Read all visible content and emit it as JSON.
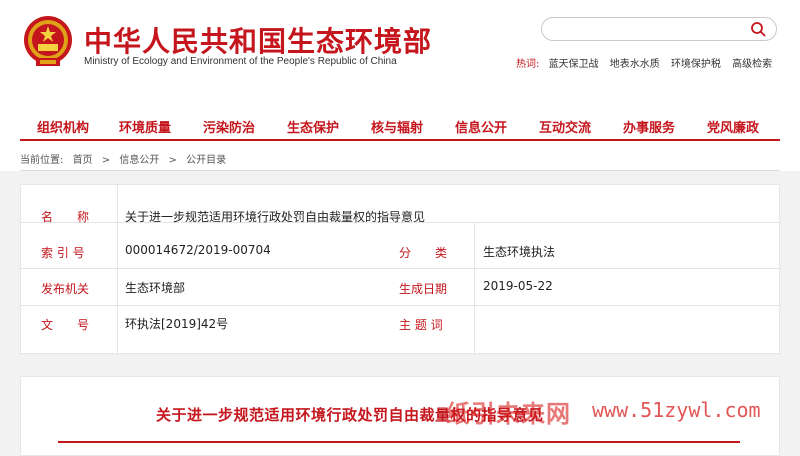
{
  "header": {
    "title_cn": "中华人民共和国生态环境部",
    "title_en": "Ministry of Ecology and Environment of the People's Republic of China",
    "emblem_icon": "national-emblem-icon",
    "brand_color": "#c4161c"
  },
  "search": {
    "placeholder": "",
    "icon": "search-icon"
  },
  "hotwords": {
    "label": "热词:",
    "items": [
      "蓝天保卫战",
      "地表水水质",
      "环境保护税",
      "高级检索"
    ]
  },
  "nav": {
    "items": [
      "组织机构",
      "环境质量",
      "污染防治",
      "生态保护",
      "核与辐射",
      "信息公开",
      "互动交流",
      "办事服务",
      "党风廉政"
    ]
  },
  "breadcrumb": {
    "prefix": "当前位置:",
    "items": [
      "首页",
      ">",
      "信息公开",
      ">",
      "公开目录"
    ]
  },
  "info": {
    "name_label": "名　　称",
    "name_value": "关于进一步规范适用环境行政处罚自由裁量权的指导意见",
    "index_label": "索 引 号",
    "index_value": "000014672/2019-00704",
    "category_label": "分　　类",
    "category_value": "生态环境执法",
    "issuer_label": "发布机关",
    "issuer_value": "生态环境部",
    "date_label": "生成日期",
    "date_value": "2019-05-22",
    "docno_label": "文　　号",
    "docno_value": "环执法[2019]42号",
    "subject_label": "主 题 词",
    "subject_value": ""
  },
  "document": {
    "title": "关于进一步规范适用环境行政处罚自由裁量权的指导意见"
  },
  "watermark": {
    "text_cn": "纸引未来网",
    "url": "www.51zywl.com"
  }
}
